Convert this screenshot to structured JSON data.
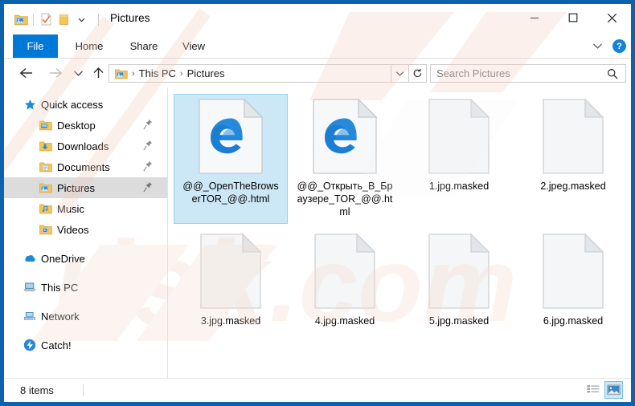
{
  "window": {
    "title": "Pictures",
    "accent_blue": "#0078d7",
    "frame_blue": "#0c62ad",
    "selection_fill": "#cce8f7",
    "selection_border": "#9ad3ef",
    "controls": {
      "minimize": "–",
      "maximize": "☐",
      "close": "✕"
    }
  },
  "quick_access_toolbar": {
    "items": [
      {
        "name": "pictures-folder-icon",
        "icon": "pictures-folder-icon"
      },
      {
        "name": "properties-icon",
        "icon": "properties-checkmark-icon"
      },
      {
        "name": "new-folder-icon",
        "icon": "new-folder-icon"
      },
      {
        "name": "customize-qat-chevron",
        "icon": "chevron-down-icon"
      }
    ]
  },
  "ribbon": {
    "tabs": [
      {
        "label": "File",
        "active": true
      },
      {
        "label": "Home",
        "active": false
      },
      {
        "label": "Share",
        "active": false
      },
      {
        "label": "View",
        "active": false
      }
    ],
    "expand_icon": "chevron-down-icon",
    "help_label": "?"
  },
  "navigation": {
    "back_icon": "←",
    "forward_icon": "→",
    "recent_icon": "∨",
    "up_icon": "↑",
    "breadcrumb": {
      "icon": "pictures-folder-icon",
      "parts": [
        "This PC",
        "Pictures"
      ],
      "separator": "›"
    },
    "address_chevron": "∨",
    "refresh_icon": "↻"
  },
  "search": {
    "placeholder": "Search Pictures",
    "icon": "search-icon"
  },
  "sidebar": {
    "items": [
      {
        "label": "Quick access",
        "icon": "star-icon",
        "level": 0,
        "pinned": false,
        "selected": false,
        "gap_before": false
      },
      {
        "label": "Desktop",
        "icon": "desktop-folder-icon",
        "level": 1,
        "pinned": true,
        "selected": false,
        "gap_before": false
      },
      {
        "label": "Downloads",
        "icon": "downloads-folder-icon",
        "level": 1,
        "pinned": true,
        "selected": false,
        "gap_before": false
      },
      {
        "label": "Documents",
        "icon": "documents-folder-icon",
        "level": 1,
        "pinned": true,
        "selected": false,
        "gap_before": false
      },
      {
        "label": "Pictures",
        "icon": "pictures-folder-icon",
        "level": 1,
        "pinned": true,
        "selected": true,
        "gap_before": false
      },
      {
        "label": "Music",
        "icon": "music-folder-icon",
        "level": 1,
        "pinned": false,
        "selected": false,
        "gap_before": false
      },
      {
        "label": "Videos",
        "icon": "videos-folder-icon",
        "level": 1,
        "pinned": false,
        "selected": false,
        "gap_before": false
      },
      {
        "label": "OneDrive",
        "icon": "onedrive-cloud-icon",
        "level": 0,
        "pinned": false,
        "selected": false,
        "gap_before": true
      },
      {
        "label": "This PC",
        "icon": "this-pc-icon",
        "level": 0,
        "pinned": false,
        "selected": false,
        "gap_before": true
      },
      {
        "label": "Network",
        "icon": "network-icon",
        "level": 0,
        "pinned": false,
        "selected": false,
        "gap_before": true
      },
      {
        "label": "Catch!",
        "icon": "catch-icon",
        "level": 0,
        "pinned": false,
        "selected": false,
        "gap_before": true
      }
    ]
  },
  "files": [
    {
      "name": "@@_OpenTheBrowserTOR_@@.html",
      "icon": "edge-html-file-icon",
      "selected": true
    },
    {
      "name": "@@_Открыть_В_Браузере_TOR_@@.html",
      "icon": "edge-html-file-icon",
      "selected": false
    },
    {
      "name": "1.jpg.masked",
      "icon": "blank-file-icon",
      "selected": false
    },
    {
      "name": "2.jpeg.masked",
      "icon": "blank-file-icon",
      "selected": false
    },
    {
      "name": "3.jpg.masked",
      "icon": "blank-file-icon",
      "selected": false
    },
    {
      "name": "4.jpg.masked",
      "icon": "blank-file-icon",
      "selected": false
    },
    {
      "name": "5.jpg.masked",
      "icon": "blank-file-icon",
      "selected": false
    },
    {
      "name": "6.jpg.masked",
      "icon": "blank-file-icon",
      "selected": false
    }
  ],
  "status": {
    "item_count": "8 items",
    "views": [
      {
        "name": "details-view-button",
        "icon": "details-view-icon",
        "active": false
      },
      {
        "name": "large-icons-view-button",
        "icon": "large-icons-view-icon",
        "active": true
      }
    ]
  },
  "watermark": {
    "text": "pcrisk.com"
  }
}
